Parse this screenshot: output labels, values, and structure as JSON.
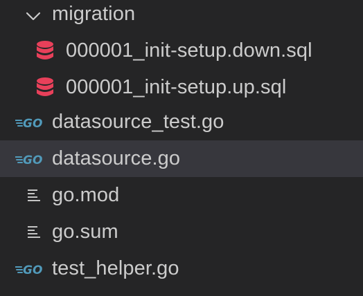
{
  "tree": {
    "folder": {
      "label": "migration",
      "icon": "chevron-down-icon",
      "expanded": true
    },
    "items": [
      {
        "label": "000001_init-setup.down.sql",
        "icon": "database-icon",
        "icon_color": "#e8405a"
      },
      {
        "label": "000001_init-setup.up.sql",
        "icon": "database-icon",
        "icon_color": "#e8405a"
      },
      {
        "label": "datasource_test.go",
        "icon": "go-file-icon",
        "icon_color": "#519aba"
      },
      {
        "label": "datasource.go",
        "icon": "go-file-icon",
        "icon_color": "#519aba",
        "selected": true
      },
      {
        "label": "go.mod",
        "icon": "text-file-icon",
        "icon_color": "#c5c5c5"
      },
      {
        "label": "go.sum",
        "icon": "text-file-icon",
        "icon_color": "#c5c5c5"
      },
      {
        "label": "test_helper.go",
        "icon": "go-file-icon",
        "icon_color": "#519aba"
      }
    ]
  }
}
